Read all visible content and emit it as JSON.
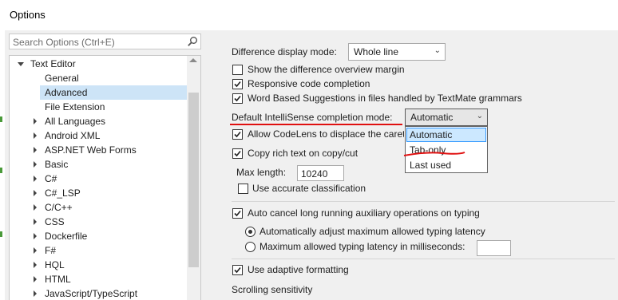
{
  "window": {
    "title": "Options"
  },
  "search": {
    "placeholder": "Search Options (Ctrl+E)",
    "icon": "search-icon"
  },
  "tree": {
    "items": [
      {
        "label": "Text Editor",
        "level": 0,
        "expander": "expanded"
      },
      {
        "label": "General",
        "level": 1,
        "expander": "none"
      },
      {
        "label": "Advanced",
        "level": 1,
        "expander": "none",
        "selected": true
      },
      {
        "label": "File Extension",
        "level": 1,
        "expander": "none"
      },
      {
        "label": "All Languages",
        "level": 1,
        "expander": "collapsed"
      },
      {
        "label": "Android XML",
        "level": 1,
        "expander": "collapsed"
      },
      {
        "label": "ASP.NET Web Forms",
        "level": 1,
        "expander": "collapsed"
      },
      {
        "label": "Basic",
        "level": 1,
        "expander": "collapsed"
      },
      {
        "label": "C#",
        "level": 1,
        "expander": "collapsed"
      },
      {
        "label": "C#_LSP",
        "level": 1,
        "expander": "collapsed"
      },
      {
        "label": "C/C++",
        "level": 1,
        "expander": "collapsed"
      },
      {
        "label": "CSS",
        "level": 1,
        "expander": "collapsed"
      },
      {
        "label": "Dockerfile",
        "level": 1,
        "expander": "collapsed"
      },
      {
        "label": "F#",
        "level": 1,
        "expander": "collapsed"
      },
      {
        "label": "HQL",
        "level": 1,
        "expander": "collapsed"
      },
      {
        "label": "HTML",
        "level": 1,
        "expander": "collapsed"
      },
      {
        "label": "JavaScript/TypeScript",
        "level": 1,
        "expander": "collapsed"
      }
    ]
  },
  "settings": {
    "diff_mode_label": "Difference display mode:",
    "diff_mode_value": "Whole line",
    "show_overview_margin": {
      "label": "Show the difference overview margin",
      "checked": false
    },
    "responsive_completion": {
      "label": "Responsive code completion",
      "checked": true
    },
    "word_based_suggestions": {
      "label": "Word Based Suggestions in files handled by TextMate grammars",
      "checked": true
    },
    "completion_mode_label": "Default IntelliSense completion mode:",
    "completion_mode_value": "Automatic",
    "completion_mode_options": [
      "Automatic",
      "Tab-only",
      "Last used"
    ],
    "codelens_caret": {
      "label": "Allow CodeLens to displace the caret",
      "checked": true
    },
    "copy_rich_text": {
      "label": "Copy rich text on copy/cut",
      "checked": true
    },
    "max_length_label": "Max length:",
    "max_length_value": "10240",
    "accurate_classification": {
      "label": "Use accurate classification",
      "checked": false
    },
    "auto_cancel": {
      "label": "Auto cancel long running auxiliary operations on typing",
      "checked": true
    },
    "auto_adjust_latency": {
      "label": "Automatically adjust maximum allowed typing latency",
      "selected": true
    },
    "max_latency": {
      "label": "Maximum allowed typing latency in milliseconds:",
      "selected": false,
      "value": ""
    },
    "adaptive_formatting": {
      "label": "Use adaptive formatting",
      "checked": true
    },
    "scrolling_sensitivity_label": "Scrolling sensitivity"
  },
  "colors": {
    "annotation_red": "#e01010",
    "selection": "#cde4f7",
    "dropdown_highlight": "#cce8ff"
  }
}
